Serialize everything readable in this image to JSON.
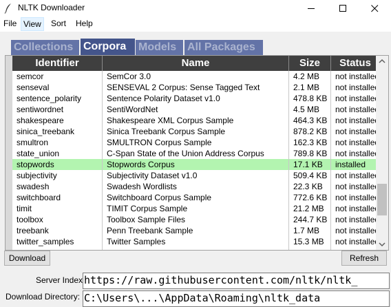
{
  "window": {
    "title": "NLTK Downloader",
    "icon": "feather-icon"
  },
  "menu": {
    "items": [
      "File",
      "View",
      "Sort",
      "Help"
    ],
    "active": "View"
  },
  "tabs": [
    {
      "label": "Collections",
      "active": false
    },
    {
      "label": "Corpora",
      "active": true
    },
    {
      "label": "Models",
      "active": false
    },
    {
      "label": "All Packages",
      "active": false
    }
  ],
  "table": {
    "columns": [
      "Identifier",
      "Name",
      "Size",
      "Status"
    ],
    "selected_identifier": "stopwords",
    "rows": [
      {
        "id": "semcor",
        "name": "SemCor 3.0",
        "size": "4.2 MB",
        "status": "not installed"
      },
      {
        "id": "senseval",
        "name": "SENSEVAL 2 Corpus: Sense Tagged Text",
        "size": "2.1 MB",
        "status": "not installed"
      },
      {
        "id": "sentence_polarity",
        "name": "Sentence Polarity Dataset v1.0",
        "size": "478.8 KB",
        "status": "not installed"
      },
      {
        "id": "sentiwordnet",
        "name": "SentiWordNet",
        "size": "4.5 MB",
        "status": "not installed"
      },
      {
        "id": "shakespeare",
        "name": "Shakespeare XML Corpus Sample",
        "size": "464.3 KB",
        "status": "not installed"
      },
      {
        "id": "sinica_treebank",
        "name": "Sinica Treebank Corpus Sample",
        "size": "878.2 KB",
        "status": "not installed"
      },
      {
        "id": "smultron",
        "name": "SMULTRON Corpus Sample",
        "size": "162.3 KB",
        "status": "not installed"
      },
      {
        "id": "state_union",
        "name": "C-Span State of the Union Address Corpus",
        "size": "789.8 KB",
        "status": "not installed"
      },
      {
        "id": "stopwords",
        "name": "Stopwords Corpus",
        "size": "17.1 KB",
        "status": "installed"
      },
      {
        "id": "subjectivity",
        "name": "Subjectivity Dataset v1.0",
        "size": "509.4 KB",
        "status": "not installed"
      },
      {
        "id": "swadesh",
        "name": "Swadesh Wordlists",
        "size": "22.3 KB",
        "status": "not installed"
      },
      {
        "id": "switchboard",
        "name": "Switchboard Corpus Sample",
        "size": "772.6 KB",
        "status": "not installed"
      },
      {
        "id": "timit",
        "name": "TIMIT Corpus Sample",
        "size": "21.2 MB",
        "status": "not installed"
      },
      {
        "id": "toolbox",
        "name": "Toolbox Sample Files",
        "size": "244.7 KB",
        "status": "not installed"
      },
      {
        "id": "treebank",
        "name": "Penn Treebank Sample",
        "size": "1.7 MB",
        "status": "not installed"
      },
      {
        "id": "twitter_samples",
        "name": "Twitter Samples",
        "size": "15.3 MB",
        "status": "not installed"
      }
    ]
  },
  "buttons": {
    "download": "Download",
    "refresh": "Refresh"
  },
  "server": {
    "label": "Server Index:",
    "value": "https://raw.githubusercontent.com/nltk/nltk_"
  },
  "download_dir": {
    "label": "Download Directory:",
    "value": "C:\\Users\\...\\AppData\\Roaming\\nltk_data"
  },
  "colors": {
    "tab_bg": "#6373a7",
    "tab_active_bg": "#44558b",
    "header_bg": "#3f3f3f",
    "selected_row": "#b3f4b0"
  }
}
